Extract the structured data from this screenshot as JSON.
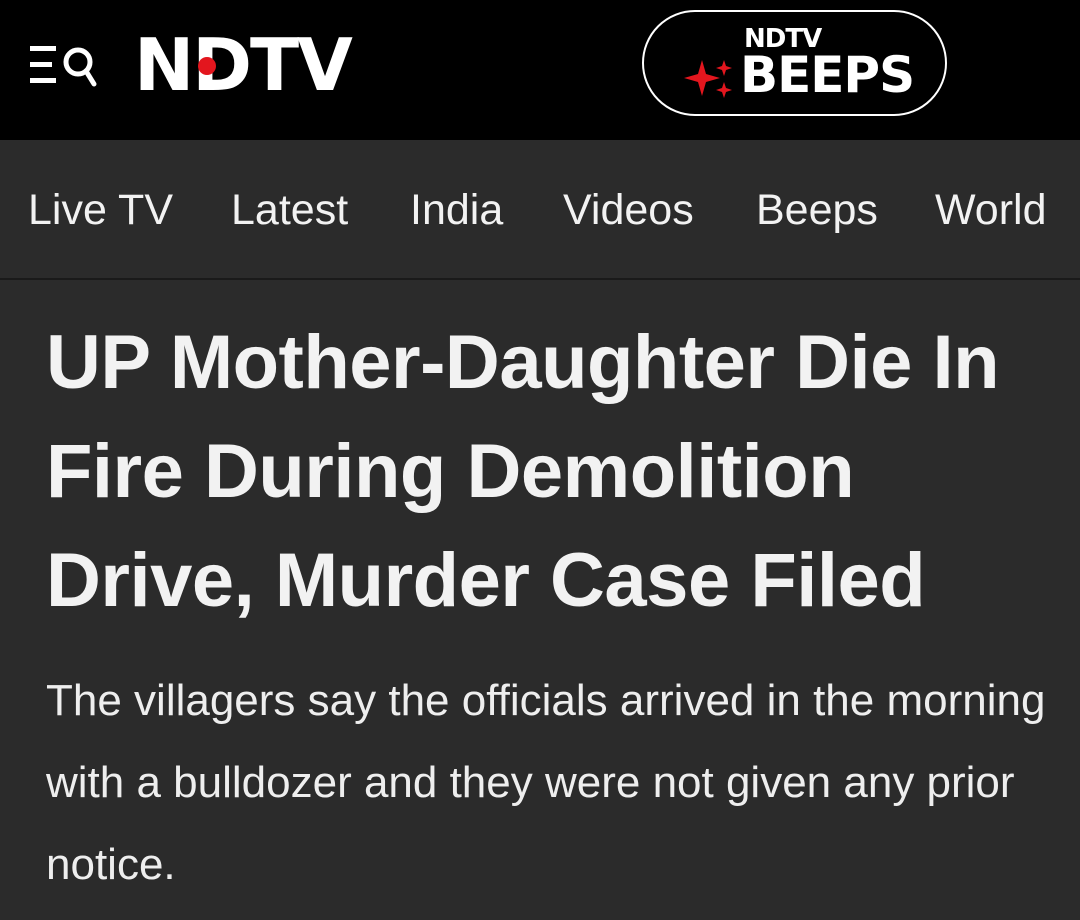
{
  "header": {
    "menu_icon": "menu-search-icon",
    "logo_text_n": "N",
    "logo_text_rest": "DTV",
    "beeps": {
      "small_label": "NDTV",
      "big_label": "BEEPS",
      "icon": "sparkle-icon",
      "accent_color": "#e3161e"
    }
  },
  "nav": {
    "items": [
      {
        "label": "Live TV"
      },
      {
        "label": "Latest"
      },
      {
        "label": "India"
      },
      {
        "label": "Videos"
      },
      {
        "label": "Beeps"
      },
      {
        "label": "World"
      }
    ]
  },
  "article": {
    "headline": "UP Mother-Daughter Die In Fire During Demolition Drive, Murder Case Filed",
    "summary": "The villagers say the officials arrived in the morning with a bulldozer and they were not given any prior notice."
  },
  "colors": {
    "topbar_bg": "#000000",
    "page_bg": "#2b2b2b",
    "text": "#f2f2f2",
    "brand_red": "#e3161e"
  }
}
